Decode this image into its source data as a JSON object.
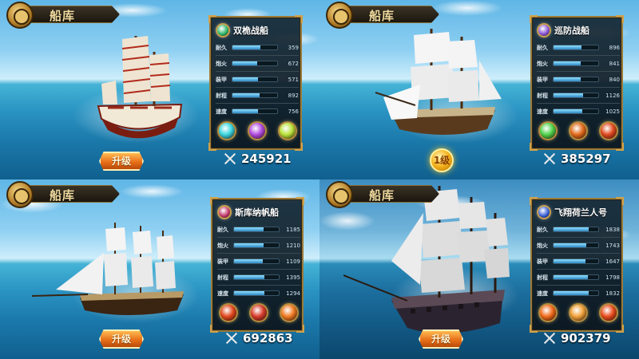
{
  "screen_title": "船库",
  "upgrade_label": "升级",
  "cards": [
    {
      "ship_name": "双桅战船",
      "badge_color": "#2fb86a",
      "stats": [
        {
          "label": "耐久",
          "value": "359",
          "fill": 0.62
        },
        {
          "label": "炮火",
          "value": "672",
          "fill": 0.55
        },
        {
          "label": "装甲",
          "value": "571",
          "fill": 0.58
        },
        {
          "label": "射程",
          "value": "892",
          "fill": 0.6
        },
        {
          "label": "速度",
          "value": "756",
          "fill": 0.58
        }
      ],
      "skills": [
        {
          "icon": "cyan-gem-skill-icon",
          "color": "#39d6e0"
        },
        {
          "icon": "purple-gem-skill-icon",
          "color": "#b04be0"
        },
        {
          "icon": "lime-gem-skill-icon",
          "color": "#b9e23a"
        }
      ],
      "power": "245921",
      "action": "upgrade-button"
    },
    {
      "ship_name": "巡防战船",
      "badge_color": "#8a54d6",
      "stats": [
        {
          "label": "耐久",
          "value": "896",
          "fill": 0.62
        },
        {
          "label": "炮火",
          "value": "841",
          "fill": 0.6
        },
        {
          "label": "装甲",
          "value": "840",
          "fill": 0.6
        },
        {
          "label": "射程",
          "value": "1126",
          "fill": 0.66
        },
        {
          "label": "速度",
          "value": "1025",
          "fill": 0.64
        }
      ],
      "skills": [
        {
          "icon": "green-gem-skill-icon",
          "color": "#4fd24b"
        },
        {
          "icon": "fire-skill-icon",
          "color": "#e26a1c"
        },
        {
          "icon": "flame-skill-icon",
          "color": "#e0481e"
        }
      ],
      "power": "385297",
      "action": "coin-button",
      "coin_label": "1级"
    },
    {
      "ship_name": "斯库纳帆船",
      "badge_color": "#c0386a",
      "stats": [
        {
          "label": "耐久",
          "value": "1185",
          "fill": 0.66
        },
        {
          "label": "炮火",
          "value": "1210",
          "fill": 0.66
        },
        {
          "label": "装甲",
          "value": "1109",
          "fill": 0.65
        },
        {
          "label": "射程",
          "value": "1395",
          "fill": 0.68
        },
        {
          "label": "速度",
          "value": "1294",
          "fill": 0.67
        }
      ],
      "skills": [
        {
          "icon": "fire-rune-skill-icon",
          "color": "#e2471e"
        },
        {
          "icon": "shield-skill-icon",
          "color": "#d63a2a"
        },
        {
          "icon": "sun-skill-icon",
          "color": "#f07a22"
        }
      ],
      "power": "692863",
      "action": "upgrade-button"
    },
    {
      "ship_name": "飞翔荷兰人号",
      "badge_color": "#3a5fd6",
      "stats": [
        {
          "label": "耐久",
          "value": "1838",
          "fill": 0.78
        },
        {
          "label": "炮火",
          "value": "1743",
          "fill": 0.74
        },
        {
          "label": "装甲",
          "value": "1647",
          "fill": 0.72
        },
        {
          "label": "射程",
          "value": "1798",
          "fill": 0.76
        },
        {
          "label": "速度",
          "value": "1832",
          "fill": 0.78
        }
      ],
      "skills": [
        {
          "icon": "fireball-skill-icon",
          "color": "#f06a1a"
        },
        {
          "icon": "explosion-skill-icon",
          "color": "#f2a23a"
        },
        {
          "icon": "flame-burst-skill-icon",
          "color": "#e84a1c"
        }
      ],
      "power": "902379",
      "action": "upgrade-button"
    }
  ]
}
